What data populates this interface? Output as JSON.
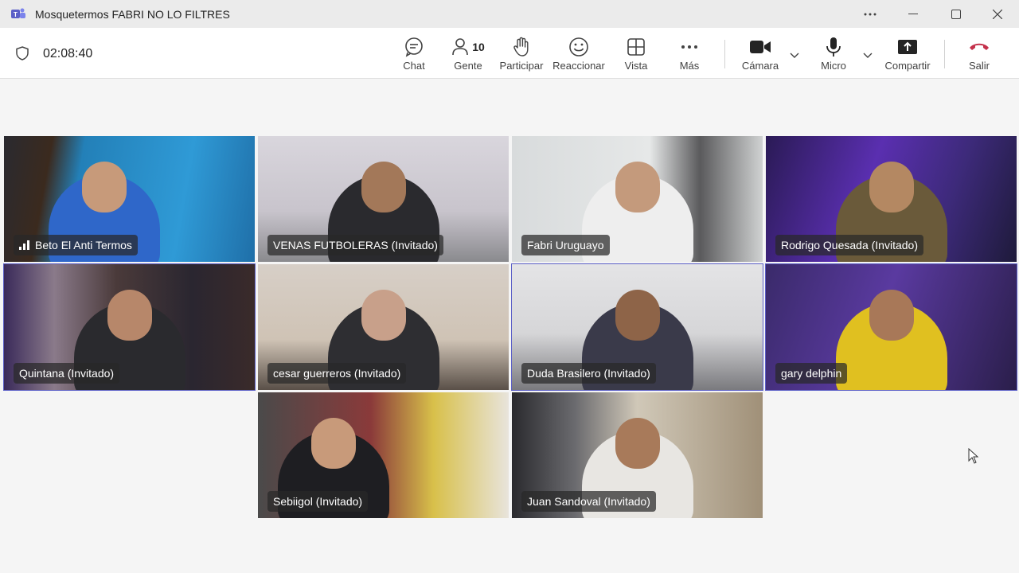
{
  "window": {
    "title": "Mosquetermos FABRI NO LO FILTRES"
  },
  "meeting": {
    "timer": "02:08:40",
    "people_count": "10"
  },
  "toolbar": {
    "chat": "Chat",
    "people": "Gente",
    "raise": "Participar",
    "react": "Reaccionar",
    "view": "Vista",
    "more": "Más",
    "camera": "Cámara",
    "mic": "Micro",
    "share": "Compartir",
    "leave": "Salir"
  },
  "colors": {
    "accent": "#5b5fc7",
    "leave": "#c4314b"
  },
  "participants": [
    {
      "name": "Beto El Anti Termos",
      "speaking": false
    },
    {
      "name": "VENAS FUTBOLERAS (Invitado)",
      "speaking": false
    },
    {
      "name": "Fabri Uruguayo",
      "speaking": false
    },
    {
      "name": "Rodrigo Quesada (Invitado)",
      "speaking": false
    },
    {
      "name": "Quintana (Invitado)",
      "speaking": true
    },
    {
      "name": "cesar guerreros (Invitado)",
      "speaking": false
    },
    {
      "name": "Duda Brasilero (Invitado)",
      "speaking": true
    },
    {
      "name": "gary delphin",
      "speaking": true
    },
    {
      "name": "Sebiigol (Invitado)",
      "speaking": false
    },
    {
      "name": "Juan Sandoval (Invitado)",
      "speaking": false
    }
  ]
}
